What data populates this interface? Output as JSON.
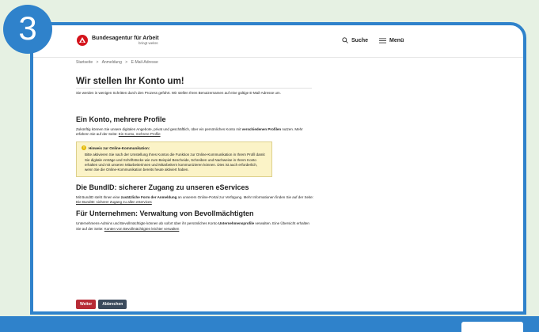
{
  "step": {
    "number": "3"
  },
  "header": {
    "logo_title": "Bundesagentur für Arbeit",
    "logo_tagline": "bringt weiter.",
    "search_label": "Suche",
    "menu_label": "Menü"
  },
  "breadcrumb": [
    "Startseite",
    ">",
    "Anmeldung",
    ">",
    "E-Mail-Adresse"
  ],
  "page": {
    "title": "Wir stellen Ihr Konto um!",
    "lead": "Sie werden in wenigen Schritten durch den Prozess geführt. Wir stellen Ihren Benutzernamen auf eine gültige E-Mail-Adresse um."
  },
  "section1": {
    "heading": "Ein Konto, mehrere Profile",
    "text_before": "Zukünftig können Sie unsere digitalen Angebote, privat und geschäftlich, über ein persönliches Konto mit ",
    "text_bold": "verschiedenen Profilen",
    "text_after": " nutzen. Mehr erfahren Sie auf der Seite: ",
    "link": "Ein Konto, mehrere Profile"
  },
  "notice": {
    "title": "Hinweis zur Online-Kommunikation:",
    "body": "Bitte aktivieren Sie nach der Umstellung Ihres Kontos die Funktion zur Online-Kommunikation in Ihrem Profil damit Sie digitale Anträge und Schriftstücke wie zum Beispiel Bescheide, Schreiben und Nachweise in Ihrem Konto erhalten und mit unseren Mitarbeiterinnen und Mitarbeitern kommunizieren können. Dies ist auch erforderlich, wenn Sie die Online-Kommunikation bereits heute aktiviert haben."
  },
  "section2": {
    "heading": "Die BundID: sicherer Zugang zu unseren eServices",
    "text_before": "Mit BundID steht Ihnen eine ",
    "text_bold": "zusätzliche Form der Anmeldung",
    "text_after": " an unserem Online-Portal zur Verfügung. Mehr Informationen finden Sie auf der Seite: ",
    "link": "Die BundID: sicherer Zugang zu allen eServices"
  },
  "section3": {
    "heading": "Für Unternehmen: Verwaltung von Bevollmächtigten",
    "text_before": "Unternehmens-Admins und Bevollmächtigte können ab sofort über ihr persönliches Konto ",
    "text_bold": "Unternehmensprofile",
    "text_after": " verwalten. Eine Übersicht erhalten Sie auf der Seite: ",
    "link": "Konten von Bevollmächtigten leichter verwalten"
  },
  "actions": {
    "primary": "Weiter",
    "secondary": "Abbrechen"
  },
  "colors": {
    "accent": "#2f82cb",
    "background": "#e6f1e3",
    "primary_button": "#b72b36",
    "secondary_button": "#3b4a5c",
    "notice_bg": "#fbf3c7"
  }
}
